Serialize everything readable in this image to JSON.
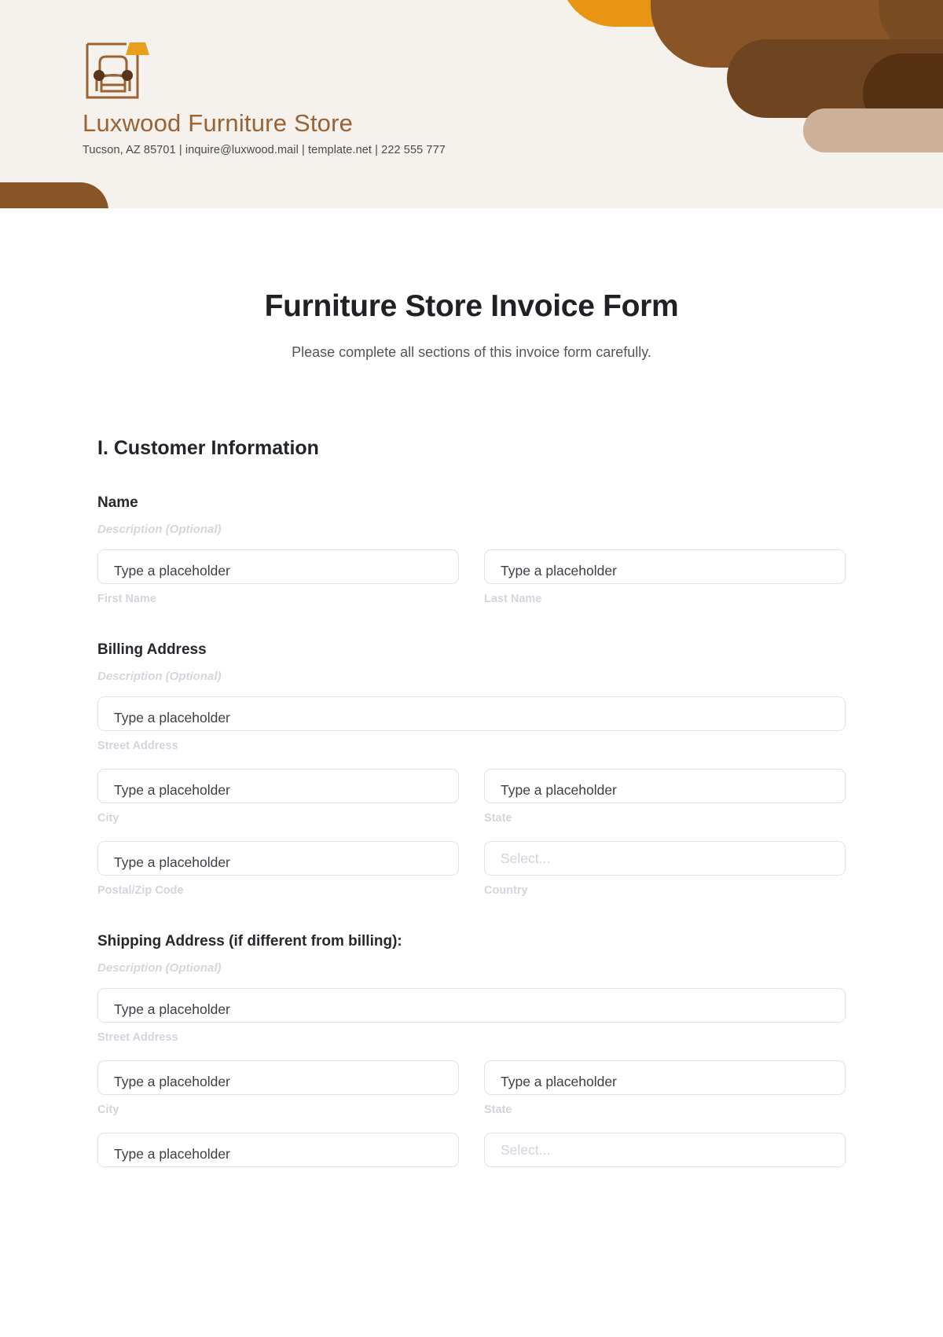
{
  "brand": {
    "logo_icon": "armchair-lamp-icon",
    "name": "Luxwood Furniture Store",
    "contact": "Tucson, AZ 85701 | inquire@luxwood.mail | template.net | 222 555 777",
    "colors": {
      "header_bg": "#f5f1ec",
      "brand_text": "#9b6233",
      "accent_orange": "#e89516",
      "accent_brown": "#8a5526",
      "accent_brown_dark": "#553112",
      "accent_tan": "#cdb098"
    }
  },
  "form": {
    "title": "Furniture Store Invoice Form",
    "subtitle": "Please complete all sections of this invoice form carefully.",
    "placeholders": {
      "text": "Type a placeholder",
      "select": "Select...",
      "description": "Description (Optional)"
    },
    "sections": [
      {
        "heading": "I. Customer Information",
        "groups": [
          {
            "label": "Name",
            "description": "Description (Optional)",
            "rows": [
              {
                "fields": [
                  {
                    "type": "text",
                    "placeholder": "Type a placeholder",
                    "sub_label": "First Name"
                  },
                  {
                    "type": "text",
                    "placeholder": "Type a placeholder",
                    "sub_label": "Last Name"
                  }
                ]
              }
            ]
          },
          {
            "label": "Billing Address",
            "description": "Description (Optional)",
            "rows": [
              {
                "fields": [
                  {
                    "type": "text",
                    "placeholder": "Type a placeholder",
                    "sub_label": "Street Address"
                  }
                ]
              },
              {
                "fields": [
                  {
                    "type": "text",
                    "placeholder": "Type a placeholder",
                    "sub_label": "City"
                  },
                  {
                    "type": "text",
                    "placeholder": "Type a placeholder",
                    "sub_label": "State"
                  }
                ]
              },
              {
                "fields": [
                  {
                    "type": "text",
                    "placeholder": "Type a placeholder",
                    "sub_label": "Postal/Zip Code"
                  },
                  {
                    "type": "select",
                    "placeholder": "Select...",
                    "sub_label": "Country"
                  }
                ]
              }
            ]
          },
          {
            "label": "Shipping Address (if different from billing):",
            "description": "Description (Optional)",
            "rows": [
              {
                "fields": [
                  {
                    "type": "text",
                    "placeholder": "Type a placeholder",
                    "sub_label": "Street Address"
                  }
                ]
              },
              {
                "fields": [
                  {
                    "type": "text",
                    "placeholder": "Type a placeholder",
                    "sub_label": "City"
                  },
                  {
                    "type": "text",
                    "placeholder": "Type a placeholder",
                    "sub_label": "State"
                  }
                ]
              },
              {
                "fields": [
                  {
                    "type": "text",
                    "placeholder": "Type a placeholder",
                    "sub_label": ""
                  },
                  {
                    "type": "select",
                    "placeholder": "Select...",
                    "sub_label": ""
                  }
                ]
              }
            ]
          }
        ]
      }
    ]
  }
}
